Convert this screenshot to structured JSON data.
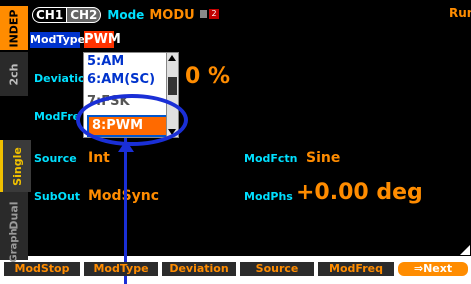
{
  "sidebar": {
    "indep_label": "INDEP",
    "ch2_label": "2ch",
    "single_label": "Single",
    "dual_label": "Dual",
    "graph_label": "Graph"
  },
  "header": {
    "ch1_label": "CH1",
    "ch2_label": "CH2",
    "mode_label": "Mode",
    "mode_value": "MODU",
    "mod_indicator_number": "2",
    "run_label": "Run"
  },
  "params": {
    "modtype_label": "ModType",
    "modtype_value": "PWM",
    "deviation_label": "Deviation",
    "deviation_value": "0 %",
    "modfreq_label": "ModFre",
    "source_label": "Source",
    "source_value": "Int",
    "modfctn_label": "ModFctn",
    "modfctn_value": "Sine",
    "subout_label": "SubOut",
    "subout_value": "ModSync",
    "modphs_label": "ModPhs",
    "modphs_value": "+0.00 deg"
  },
  "dropdown": {
    "options": [
      "5:AM",
      "6:AM(SC)",
      "7:FSK",
      "8:PWM"
    ],
    "selected": "8:PWM"
  },
  "softkeys": [
    "ModStop",
    "ModType",
    "Deviation",
    "Source",
    "ModFreq",
    "⇒Next"
  ],
  "colors": {
    "accent_orange": "#ff8c00",
    "label_cyan": "#00e0ff",
    "callout_blue": "#1a2fd6",
    "selected_red": "#ff3300"
  }
}
